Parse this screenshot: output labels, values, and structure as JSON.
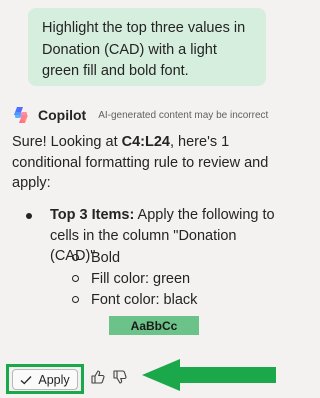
{
  "user_message": {
    "line1": "Highlight the top three values in",
    "line2": "Donation (CAD) with a light",
    "line3": "green fill and bold font."
  },
  "copilot": {
    "name": "Copilot",
    "disclaimer": "AI-generated content may be incorrect"
  },
  "response": {
    "intro_part1": "Sure! Looking at ",
    "range": "C4:L24",
    "intro_part2": ", here's 1",
    "line2": "conditional formatting rule to review and",
    "line3": "apply:",
    "rule_title": "Top 3 Items:",
    "rule_desc1": " Apply the following to",
    "rule_desc2": "cells in the column \"Donation (CAD)\"",
    "sub_items": [
      "Bold",
      "Fill color: green",
      "Font color: black"
    ],
    "sample_text": "AaBbCc"
  },
  "actions": {
    "apply_label": "Apply"
  },
  "colors": {
    "user_bubble": "#d6eedd",
    "sample_fill": "#6cc38a",
    "highlight": "#1aa84a"
  }
}
